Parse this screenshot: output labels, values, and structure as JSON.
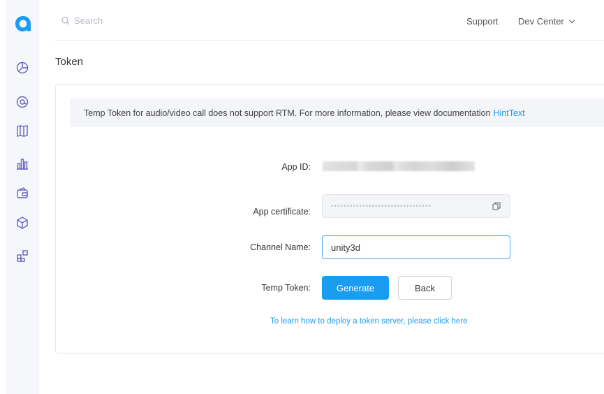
{
  "sidebar": {
    "logo": "agora-logo",
    "items": [
      {
        "icon": "pie-chart-icon"
      },
      {
        "icon": "at-sign-icon"
      },
      {
        "icon": "map-icon"
      },
      {
        "icon": "bar-chart-icon"
      },
      {
        "icon": "wallet-icon"
      },
      {
        "icon": "package-icon"
      },
      {
        "icon": "apps-icon"
      }
    ]
  },
  "topbar": {
    "search_placeholder": "Search",
    "support_label": "Support",
    "dev_center_label": "Dev Center"
  },
  "page": {
    "title": "Token"
  },
  "card": {
    "notice_text": "Temp Token for audio/video call does not support RTM. For more information, please view documentation",
    "notice_link": "HintText",
    "app_id_label": "App ID:",
    "app_certificate_label": "App certificate:",
    "app_certificate_value": "••••••••••••••••••••••••••••••••",
    "channel_name_label": "Channel Name:",
    "channel_name_value": "unity3d",
    "temp_token_label": "Temp Token:",
    "generate_label": "Generate",
    "back_label": "Back",
    "learn_link": "To learn how to deploy a token server, please click here"
  },
  "colors": {
    "accent": "#1a9cf0",
    "sidebar_icon": "#6a5fc1",
    "logo": "#1a9cf0"
  }
}
